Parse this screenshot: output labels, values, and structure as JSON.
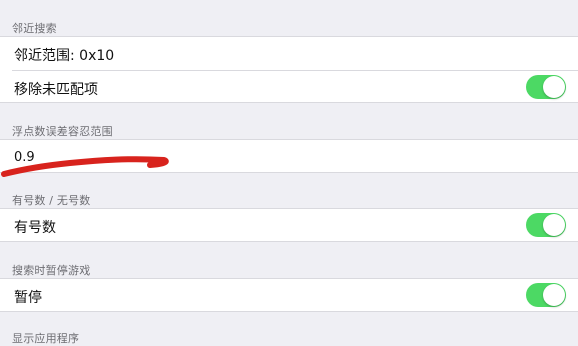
{
  "sections": {
    "neighbor_search": {
      "header": "邻近搜索",
      "range_label": "邻近范围: 0x10",
      "remove_unmatched_label": "移除未匹配项",
      "remove_unmatched_on": true
    },
    "float_tolerance": {
      "header": "浮点数误差容忍范围",
      "value": "0.9"
    },
    "signed": {
      "header": "有号数 / 无号数",
      "label": "有号数",
      "on": true
    },
    "pause_game": {
      "header": "搜索时暂停游戏",
      "label": "暂停",
      "on": true
    },
    "show_apps": {
      "header": "显示应用程序"
    }
  },
  "colors": {
    "toggle_on": "#4cd964",
    "background": "#efeff4",
    "annotation_stroke": "#d8231d"
  }
}
